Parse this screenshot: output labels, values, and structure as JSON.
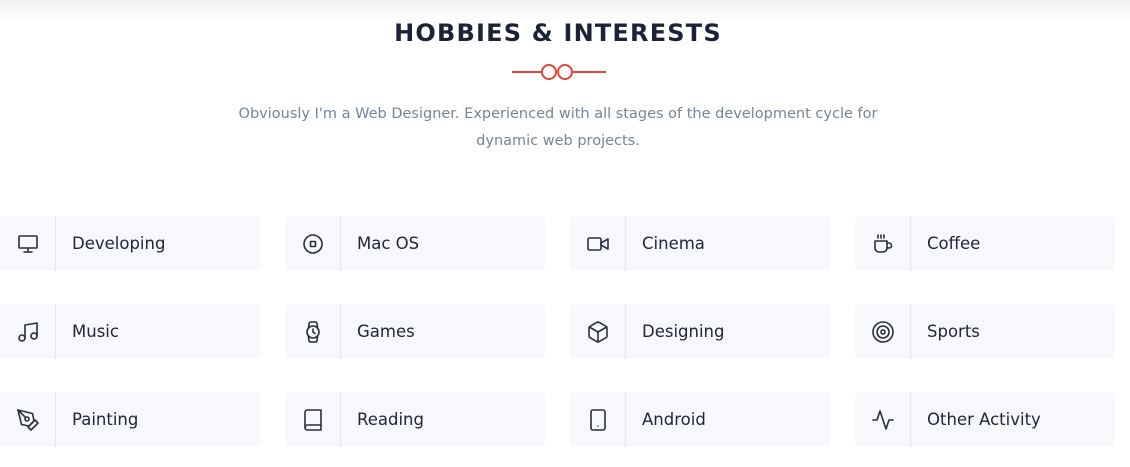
{
  "section": {
    "title": "HOBBIES & INTERESTS",
    "description": "Obviously I'm a Web Designer. Experienced with all stages of the development cycle for dynamic web projects.",
    "accent_color": "#e0473f"
  },
  "hobbies": [
    {
      "label": "Developing",
      "icon": "monitor-icon"
    },
    {
      "label": "Mac OS",
      "icon": "disc-icon"
    },
    {
      "label": "Cinema",
      "icon": "video-camera-icon"
    },
    {
      "label": "Coffee",
      "icon": "coffee-cup-icon"
    },
    {
      "label": "Music",
      "icon": "music-note-icon"
    },
    {
      "label": "Games",
      "icon": "watch-icon"
    },
    {
      "label": "Designing",
      "icon": "cube-icon"
    },
    {
      "label": "Sports",
      "icon": "target-icon"
    },
    {
      "label": "Painting",
      "icon": "pen-tool-icon"
    },
    {
      "label": "Reading",
      "icon": "book-icon"
    },
    {
      "label": "Android",
      "icon": "tablet-icon"
    },
    {
      "label": "Other Activity",
      "icon": "activity-icon"
    }
  ]
}
